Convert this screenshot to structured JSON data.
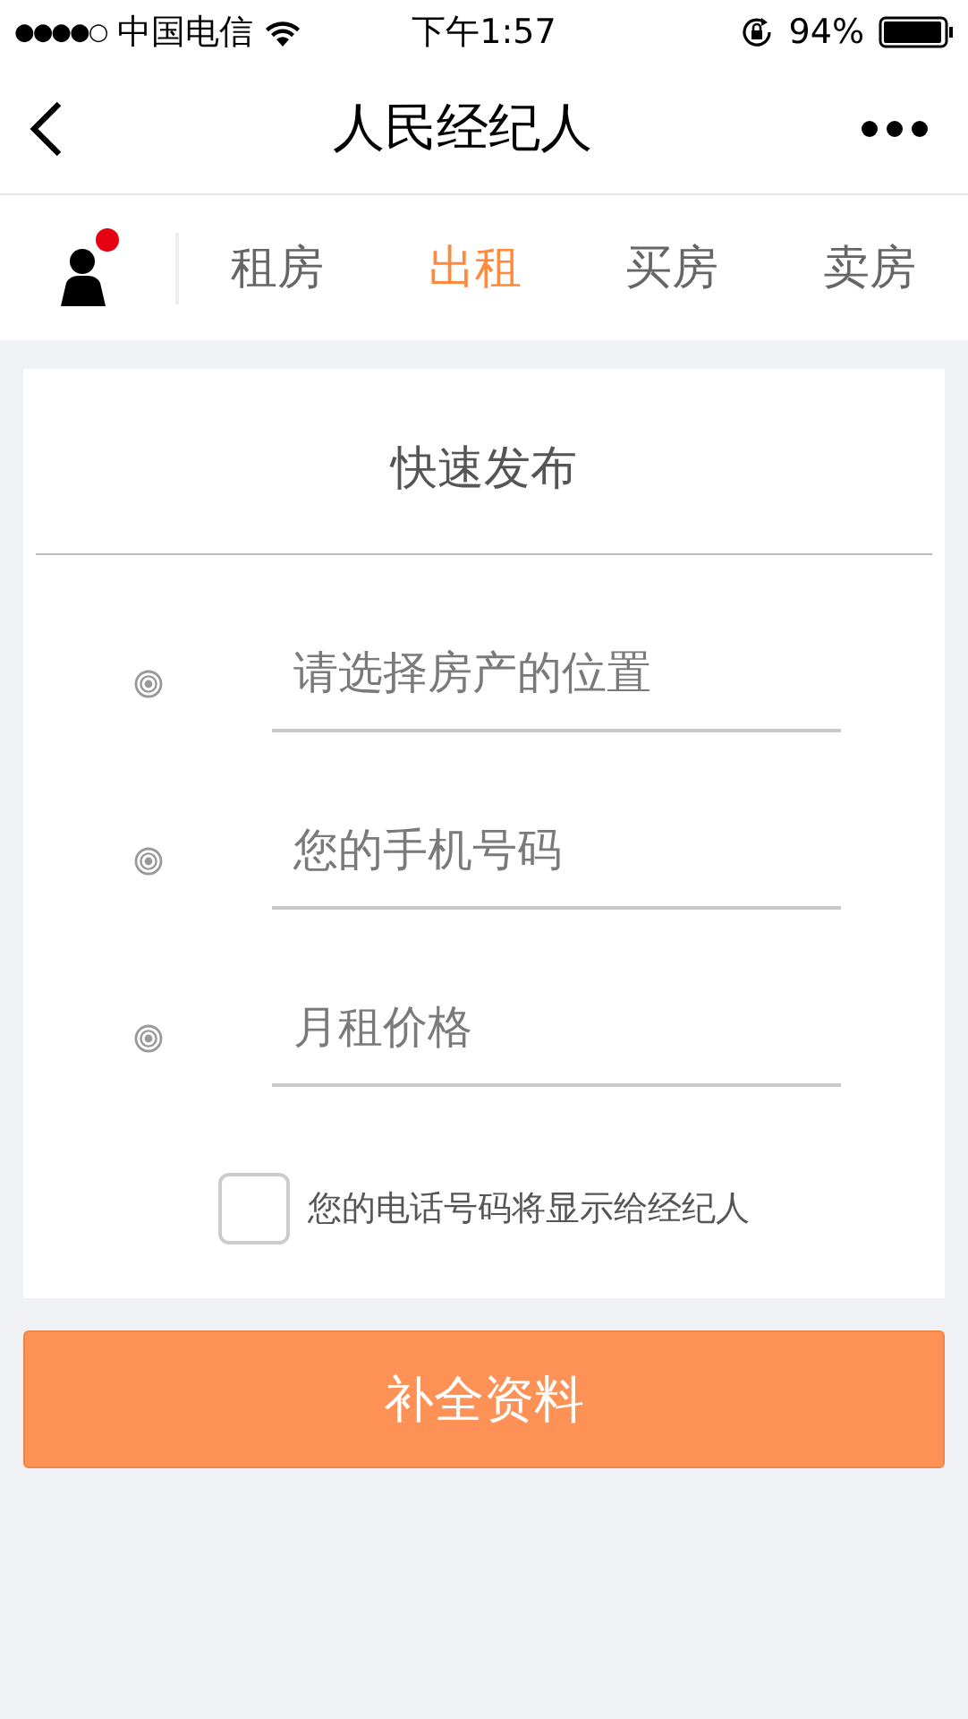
{
  "status_bar": {
    "signal": "●●●●○",
    "carrier": "中国电信",
    "time": "下午1:57",
    "battery": "94%"
  },
  "nav_bar": {
    "title": "人民经纪人"
  },
  "tabs": [
    {
      "label": "租房",
      "selected": false
    },
    {
      "label": "出租",
      "selected": true
    },
    {
      "label": "买房",
      "selected": false
    },
    {
      "label": "卖房",
      "selected": false
    }
  ],
  "form": {
    "title": "快速发布",
    "fields": [
      {
        "placeholder": "请选择房产的位置"
      },
      {
        "placeholder": "您的手机号码"
      },
      {
        "placeholder": "月租价格"
      }
    ],
    "consent": {
      "label": "您的电话号码将显示给经纪人",
      "checked": false
    },
    "submit": "补全资料"
  }
}
